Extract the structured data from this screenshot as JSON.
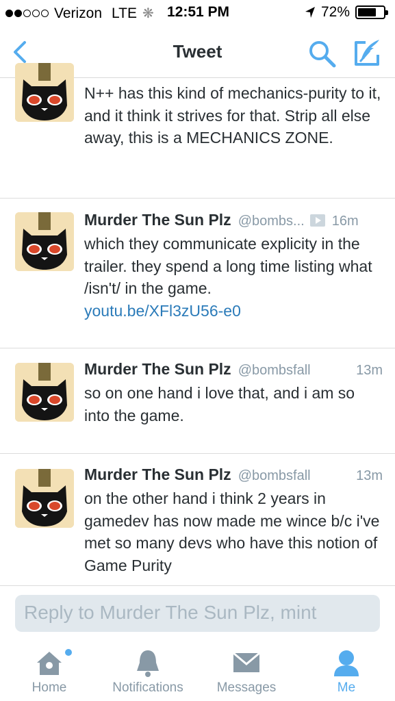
{
  "status_bar": {
    "carrier": "Verizon",
    "network": "LTE",
    "time": "12:51 PM",
    "battery": "72%",
    "battery_level": 0.72,
    "signal_bars": 2,
    "signal_total": 5
  },
  "nav": {
    "title": "Tweet"
  },
  "tweets": [
    {
      "name": "",
      "handle": "",
      "time": "",
      "text": "N++ has this kind of mechanics-purity to it, and it think it strives for that. Strip all else away, this is a MECHANICS ZONE."
    },
    {
      "name": "Murder The Sun Plz",
      "handle": "@bombs...",
      "time": "16m",
      "text": "which they communicate explicity in the trailer. they spend a long time listing what /isn't/ in the game.",
      "link": "youtu.be/XFl3zU56-e0"
    },
    {
      "name": "Murder The Sun Plz",
      "handle": "@bombsfall",
      "time": "13m",
      "text": "so on one hand i love that, and i am so into the game."
    },
    {
      "name": "Murder The Sun Plz",
      "handle": "@bombsfall",
      "time": "13m",
      "text": "on the other hand i think 2 years in gamedev has now made me wince b/c i've met so many devs who have this notion of Game Purity"
    }
  ],
  "reply": {
    "placeholder": "Reply to Murder The Sun Plz, mint"
  },
  "tabs": [
    {
      "label": "Home",
      "icon": "home-icon"
    },
    {
      "label": "Notifications",
      "icon": "bell-icon"
    },
    {
      "label": "Messages",
      "icon": "envelope-icon"
    },
    {
      "label": "Me",
      "icon": "person-icon",
      "active": true
    }
  ],
  "colors": {
    "accent": "#55acee",
    "link": "#2b7bb9",
    "secondary_text": "#8899a6",
    "primary_text": "#292f33"
  }
}
